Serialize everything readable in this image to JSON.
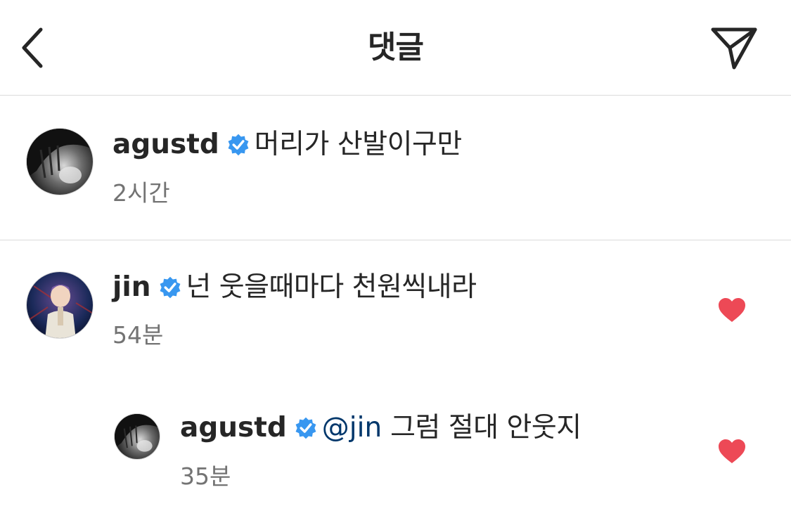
{
  "header": {
    "title": "댓글",
    "back_icon": "chevron-left-icon",
    "share_icon": "paper-plane-icon"
  },
  "colors": {
    "verified": "#3897f0",
    "heart": "#ed4956",
    "mention": "#00376b",
    "time": "#737373",
    "divider": "#dbdbdb"
  },
  "comments": [
    {
      "username": "agustd",
      "verified": true,
      "text": "머리가 산발이구만",
      "time": "2시간",
      "liked": false,
      "avatar": "black-and-white-portrait"
    },
    {
      "username": "jin",
      "verified": true,
      "text": "넌 웃을때마다 천원씩내라",
      "time": "54분",
      "liked": true,
      "avatar": "stage-performer-portrait"
    }
  ],
  "reply": {
    "username": "agustd",
    "verified": true,
    "mention": "@jin",
    "text": "그럼 절대 안웃지",
    "time": "35분",
    "liked": true,
    "avatar": "black-and-white-portrait"
  }
}
